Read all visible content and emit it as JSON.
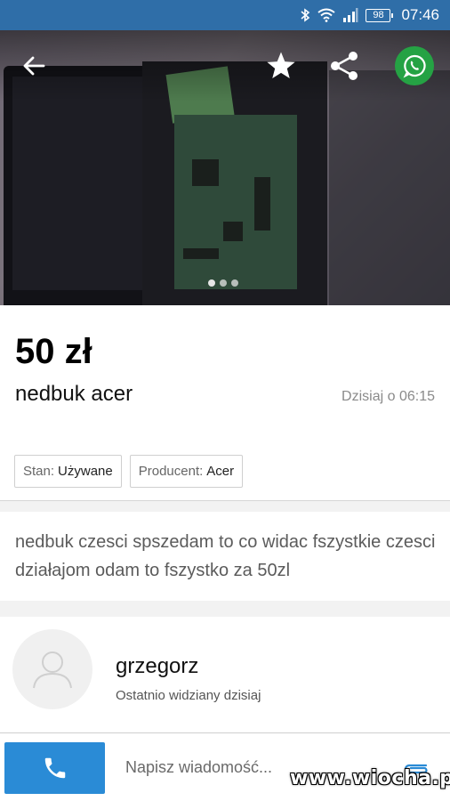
{
  "status_bar": {
    "time": "07:46",
    "battery": "98"
  },
  "listing": {
    "price": "50 zł",
    "title": "nedbuk acer",
    "date": "Dzisiaj o 06:15",
    "params": [
      {
        "key": "Stan:",
        "value": "Używane"
      },
      {
        "key": "Producent:",
        "value": "Acer"
      }
    ],
    "description": "nedbuk czesci spszedam to co widac fszystkie czesci działajom odam to fszystko za 50zl",
    "photo_indicator": {
      "count": 3,
      "active": 0
    }
  },
  "seller": {
    "name": "grzegorz",
    "last_seen": "Ostatnio widziany dzisiaj"
  },
  "bottom_bar": {
    "message_placeholder": "Napisz wiadomość..."
  },
  "watermark": "www.wiocha.pl",
  "colors": {
    "status_bar": "#2f6ea8",
    "call_button": "#2a8bd6",
    "whatsapp": "#25a244"
  },
  "icons": {
    "back": "arrow-left-icon",
    "favorite": "star-icon",
    "share": "share-icon",
    "whatsapp": "whatsapp-icon",
    "call": "phone-icon",
    "attach": "paperclip-icon",
    "avatar": "user-placeholder-icon"
  }
}
